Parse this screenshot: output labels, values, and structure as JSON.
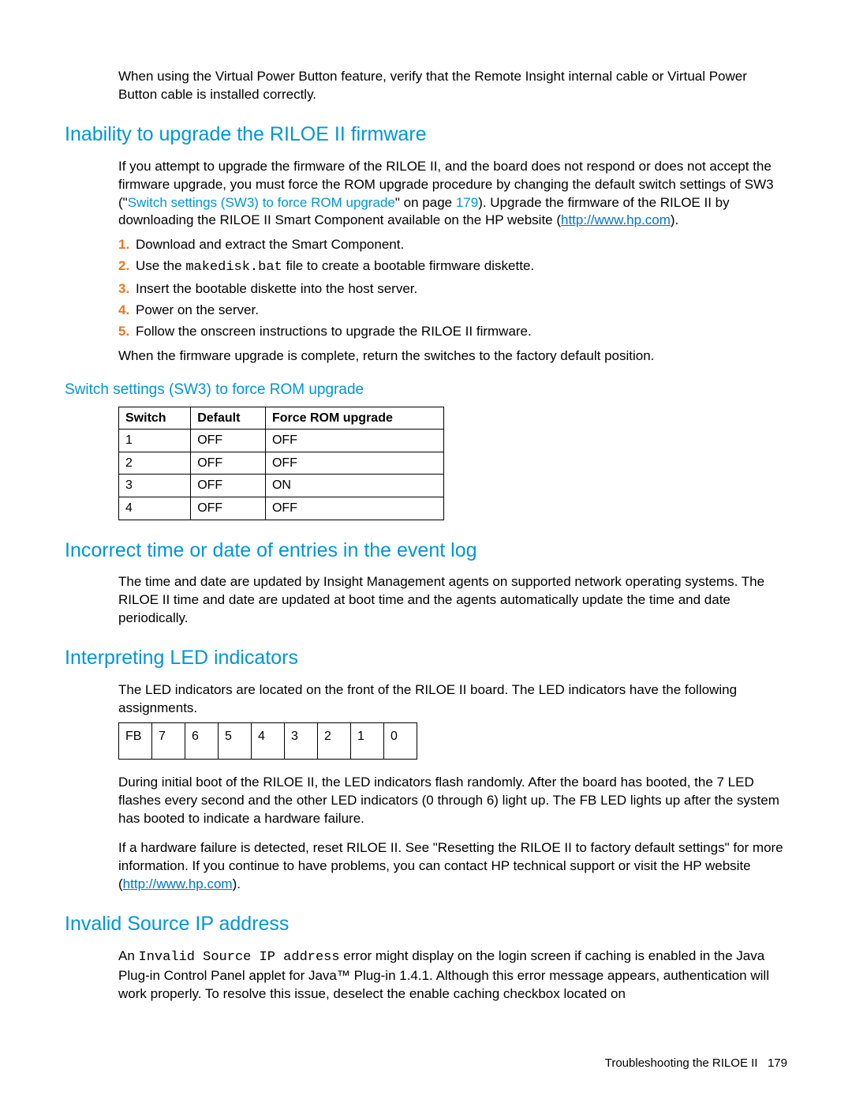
{
  "intro": "When using the Virtual Power Button feature, verify that the Remote Insight internal cable or Virtual Power Button cable is installed correctly.",
  "sec1": {
    "heading": "Inability to upgrade the RILOE II firmware",
    "p1a": "If you attempt to upgrade the firmware of the RILOE II, and the board does not respond or does not accept the firmware upgrade, you must force the ROM upgrade procedure by changing the default switch settings of SW3 (\"",
    "xref": "Switch settings (SW3) to force ROM upgrade",
    "p1b": "\" on page ",
    "pg": "179",
    "p1c": "). Upgrade the firmware of the RILOE II by downloading the RILOE II Smart Component available on the HP website (",
    "url": "http://www.hp.com",
    "p1d": ").",
    "steps": [
      "Download and extract the Smart Component.",
      "",
      "Insert the bootable diskette into the host server.",
      "Power on the server.",
      "Follow the onscreen instructions to upgrade the RILOE II firmware."
    ],
    "s2a": "Use the ",
    "s2code": "makedisk.bat",
    "s2b": " file to create a bootable firmware diskette.",
    "p2": "When the firmware upgrade is complete, return the switches to the factory default position."
  },
  "sw": {
    "heading": "Switch settings (SW3) to force ROM upgrade",
    "headers": [
      "Switch",
      "Default",
      "Force ROM upgrade"
    ],
    "rows": [
      [
        "1",
        "OFF",
        "OFF"
      ],
      [
        "2",
        "OFF",
        "OFF"
      ],
      [
        "3",
        "OFF",
        "ON"
      ],
      [
        "4",
        "OFF",
        "OFF"
      ]
    ]
  },
  "sec2": {
    "heading": "Incorrect time or date of entries in the event log",
    "p": "The time and date are updated by Insight Management agents on supported network operating systems. The RILOE II time and date are updated at boot time and the agents automatically update the time and date periodically."
  },
  "sec3": {
    "heading": "Interpreting LED indicators",
    "p1": "The LED indicators are located on the front of the RILOE II board. The LED indicators have the following assignments.",
    "cells": [
      "FB",
      "7",
      "6",
      "5",
      "4",
      "3",
      "2",
      "1",
      "0"
    ],
    "p2": "During initial boot of the RILOE II, the LED indicators flash randomly. After the board has booted, the 7 LED flashes every second and the other LED indicators (0 through 6) light up. The FB LED lights up after the system has booted to indicate a hardware failure.",
    "p3a": "If a hardware failure is detected, reset RILOE II. See \"Resetting the RILOE II to factory default settings\" for more information. If you continue to have problems, you can contact HP technical support or visit the HP website (",
    "url": "http://www.hp.com",
    "p3b": ")."
  },
  "sec4": {
    "heading": "Invalid Source IP address",
    "p1a": "An ",
    "code": "Invalid Source IP address",
    "p1b": " error might display on the login screen if caching is enabled in the Java Plug-in Control Panel applet for Java™ Plug-in 1.4.1. Although this error message appears, authentication will work properly. To resolve this issue, deselect the enable caching checkbox located on"
  },
  "footer": {
    "label": "Troubleshooting the RILOE II",
    "page": "179"
  }
}
